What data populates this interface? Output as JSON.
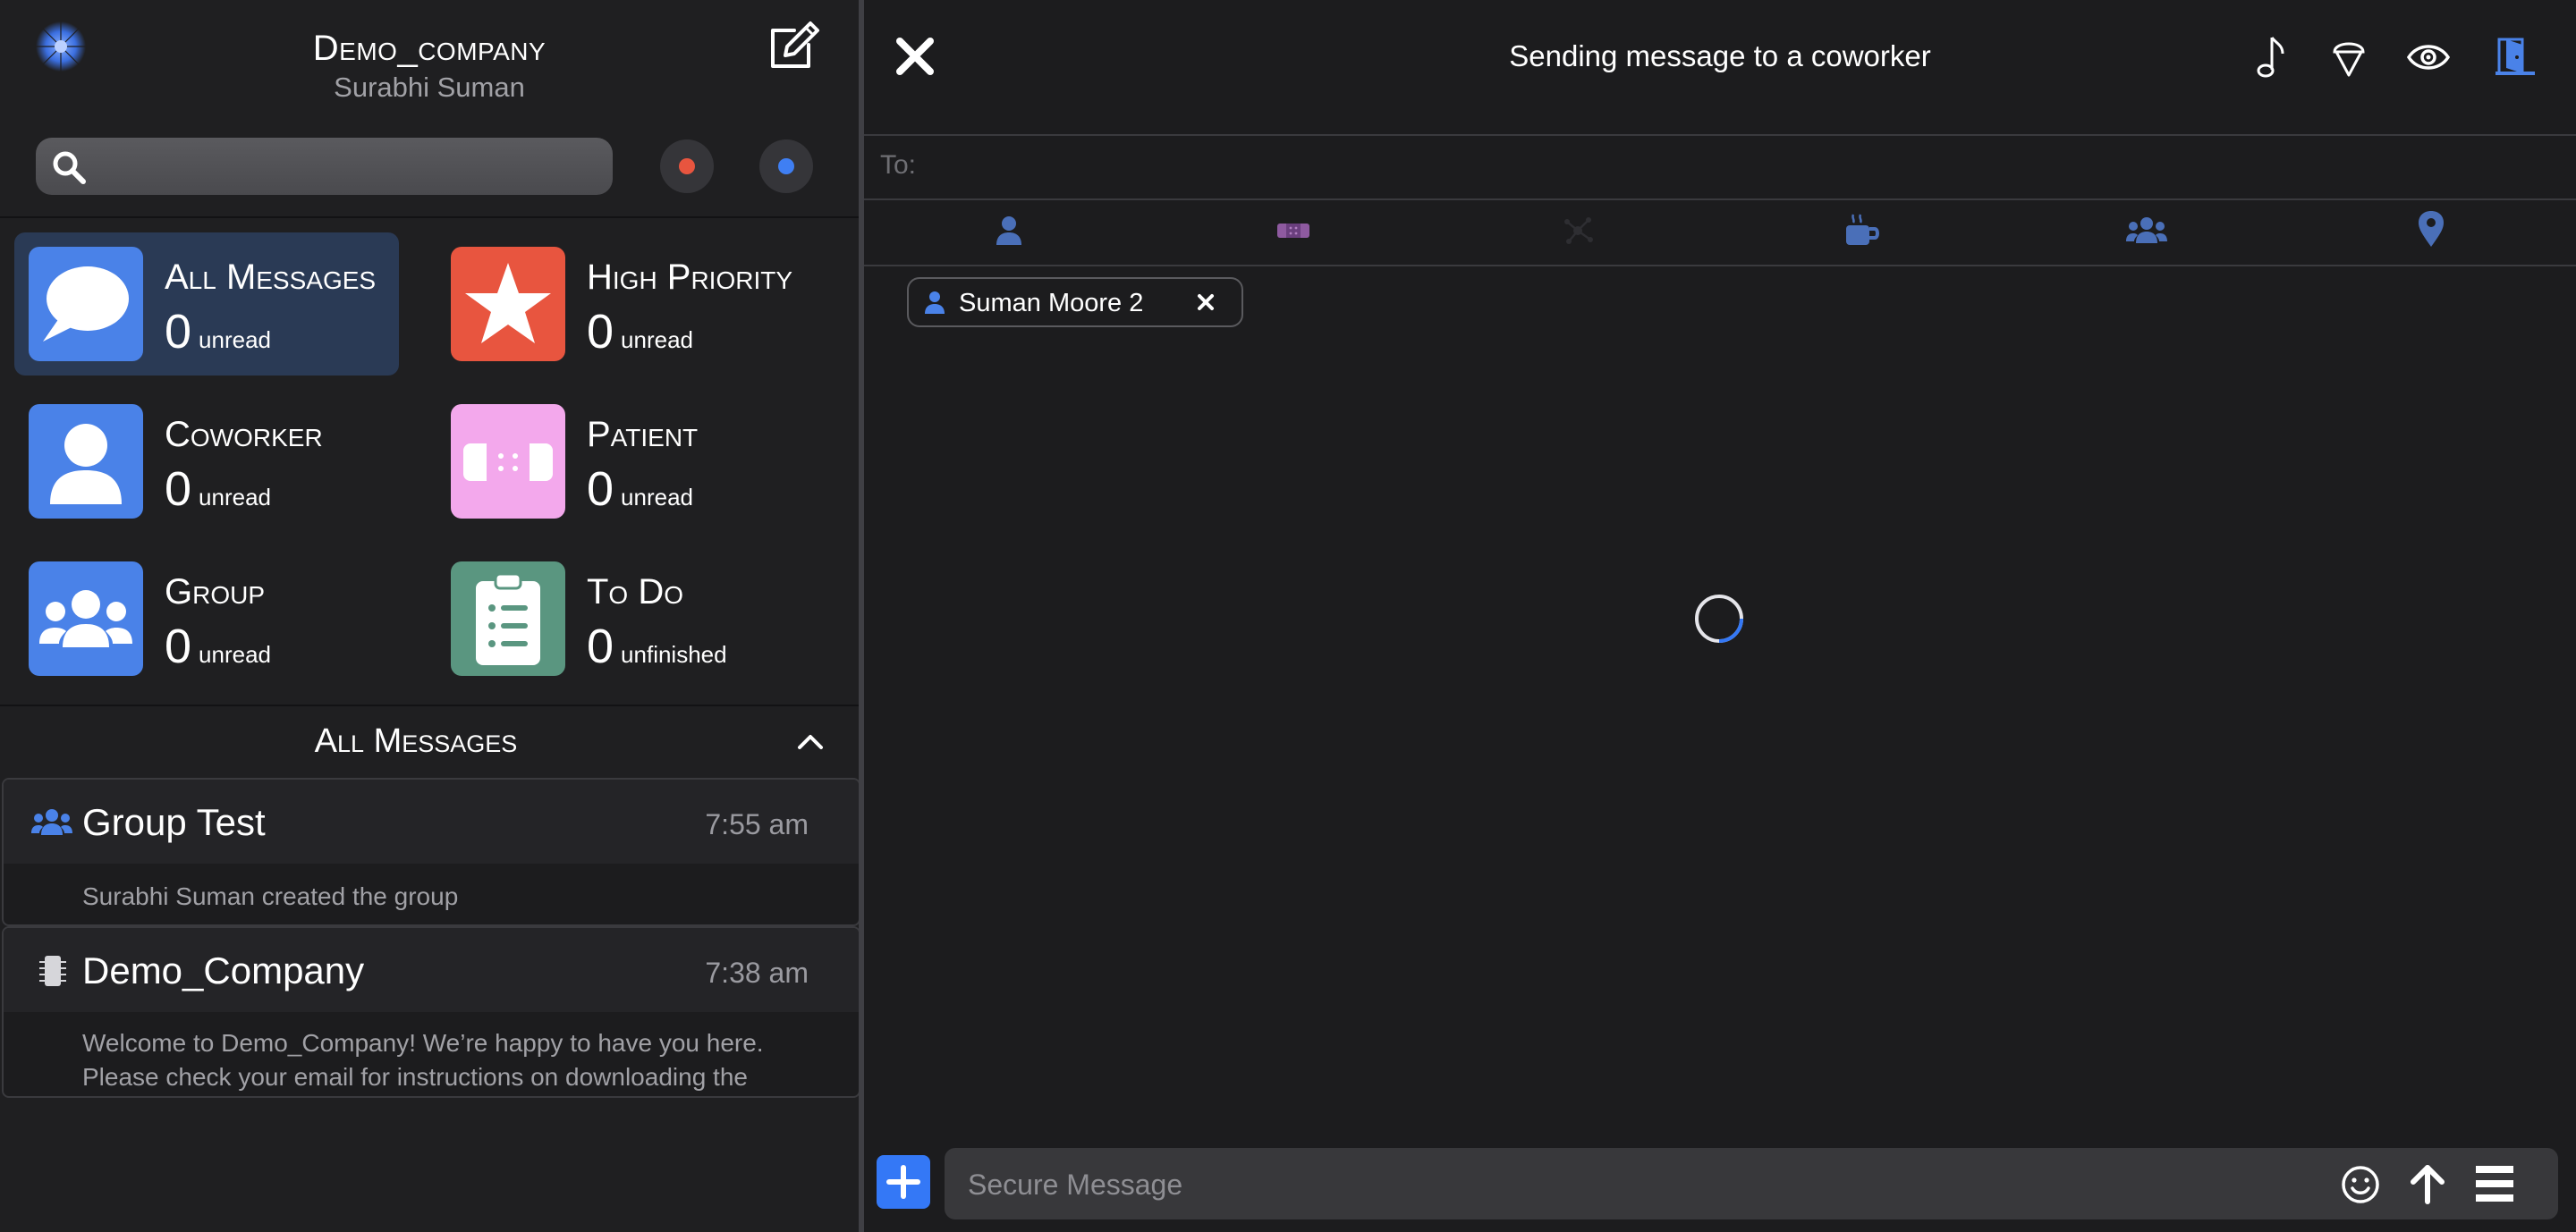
{
  "sidebar": {
    "org_name": "Demo_company",
    "user_name": "Surabhi Suman",
    "search": {
      "placeholder": "",
      "value": ""
    },
    "status_dots": [
      {
        "color": "#e8553f"
      },
      {
        "color": "#3f7ff3"
      }
    ],
    "tiles": [
      {
        "title": "All Messages",
        "count": "0",
        "unit": "unread",
        "color": "#4a82e8",
        "icon": "speech-bubble-icon",
        "selected": true
      },
      {
        "title": "High Priority",
        "count": "0",
        "unit": "unread",
        "color": "#e8553f",
        "icon": "star-icon",
        "selected": false
      },
      {
        "title": "Coworker",
        "count": "0",
        "unit": "unread",
        "color": "#4a82e8",
        "icon": "person-icon",
        "selected": false
      },
      {
        "title": "Patient",
        "count": "0",
        "unit": "unread",
        "color": "#f3a8ec",
        "icon": "bandage-icon",
        "selected": false
      },
      {
        "title": "Group",
        "count": "0",
        "unit": "unread",
        "color": "#4a82e8",
        "icon": "group-icon",
        "selected": false
      },
      {
        "title": "To Do",
        "count": "0",
        "unit": "unfinished",
        "color": "#5a9680",
        "icon": "clipboard-list-icon",
        "selected": false
      }
    ],
    "section_title": "All Messages",
    "messages": [
      {
        "icon": "group-icon",
        "title": "Group Test",
        "time": "7:55 am",
        "preview": "Surabhi Suman created the group"
      },
      {
        "icon": "device-icon",
        "title": "Demo_Company",
        "time": "7:38 am",
        "preview": "Welcome to Demo_Company! We’re happy to have you here. Please check your email for instructions on downloading the"
      }
    ]
  },
  "composer_view": {
    "title": "Sending message to a coworker",
    "header_icons": [
      "music-note-icon",
      "ice-cream-icon",
      "eye-icon",
      "door-exit-icon"
    ],
    "to_label": "To:",
    "categories": [
      "person-icon",
      "bandage-icon",
      "network-icon",
      "coffee-icon",
      "group-icon",
      "location-pin-icon"
    ],
    "recipients": [
      {
        "name": "Suman Moore 2"
      }
    ],
    "message_input": {
      "placeholder": "Secure Message",
      "value": ""
    },
    "colors": {
      "accent": "#3478f6",
      "muted_blue": "#3e64a8",
      "bandage": "#8e5aa0"
    }
  }
}
